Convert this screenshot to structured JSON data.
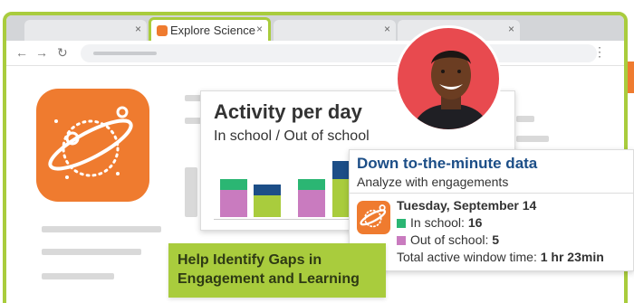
{
  "browser": {
    "active_tab_label": "Explore Science",
    "tab_close_glyph": "×",
    "nav": {
      "back": "←",
      "forward": "→",
      "reload": "↻"
    },
    "menu_glyph": "⋮"
  },
  "activity": {
    "title": "Activity per day",
    "subtitle": "In school / Out of school"
  },
  "chart_data": {
    "type": "bar",
    "stacked": true,
    "series": [
      {
        "name": "In school",
        "color": "#a9cc3d",
        "values": [
          30,
          24,
          30,
          42
        ]
      },
      {
        "name": "Out of school",
        "color": "#c97bbf",
        "values": [
          0,
          0,
          0,
          0
        ]
      }
    ],
    "bars": [
      {
        "segments": [
          {
            "color": "#c97bbf",
            "value": 30
          },
          {
            "color": "#2bb673",
            "value": 12
          }
        ]
      },
      {
        "segments": [
          {
            "color": "#a9cc3d",
            "value": 24
          },
          {
            "color": "#1c4e87",
            "value": 12
          }
        ]
      },
      {
        "segments": [
          {
            "color": "#c97bbf",
            "value": 30
          },
          {
            "color": "#2bb673",
            "value": 12
          }
        ]
      },
      {
        "segments": [
          {
            "color": "#a9cc3d",
            "value": 42
          },
          {
            "color": "#1c4e87",
            "value": 20
          }
        ]
      }
    ]
  },
  "data_card": {
    "title": "Down to-the-minute data",
    "subtitle": "Analyze with engagements",
    "date": "Tuesday, September 14",
    "in_school_label": "In school: ",
    "in_school_value": "16",
    "out_school_label": "Out of school: ",
    "out_school_value": "5",
    "total_label": "Total active window time: ",
    "total_value": "1 hr 23min",
    "in_school_color": "#2bb673",
    "out_school_color": "#c97bbf"
  },
  "callout": {
    "line1": "Help Identify Gaps in",
    "line2": "Engagement and Learning"
  },
  "colors": {
    "accent_green": "#a9cc3d",
    "brand_orange": "#ef7b2f",
    "heading_blue": "#1c4e87",
    "avatar_bg": "#e84a4f"
  },
  "icons": [
    "planet-logo-icon",
    "back-arrow-icon",
    "forward-arrow-icon",
    "reload-icon",
    "kebab-menu-icon",
    "close-icon",
    "user-avatar"
  ]
}
